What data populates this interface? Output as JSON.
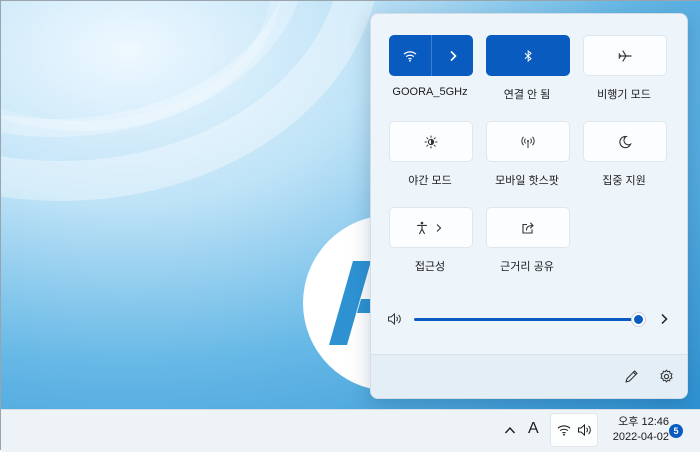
{
  "quick_settings": {
    "wifi": {
      "label": "GOORA_5GHz",
      "icon": "wifi-icon",
      "active": true
    },
    "bluetooth": {
      "label": "연결 안 됨",
      "icon": "bluetooth-icon",
      "active": true
    },
    "airplane": {
      "label": "비행기 모드",
      "icon": "airplane-icon",
      "active": false
    },
    "night_light": {
      "label": "야간 모드",
      "icon": "brightness-icon",
      "active": false
    },
    "hotspot": {
      "label": "모바일 핫스팟",
      "icon": "hotspot-icon",
      "active": false
    },
    "focus": {
      "label": "집중 지원",
      "icon": "moon-icon",
      "active": false
    },
    "accessibility": {
      "label": "접근성",
      "icon": "accessibility-icon",
      "active": false
    },
    "nearby_share": {
      "label": "근거리 공유",
      "icon": "share-icon",
      "active": false
    },
    "volume": {
      "level": 1.0,
      "icon": "speaker-icon"
    }
  },
  "taskbar": {
    "ime_indicator": "A",
    "time": "오후 12:46",
    "date": "2022-04-02",
    "notification_count": "5"
  },
  "colors": {
    "accent": "#0a5bbf"
  }
}
